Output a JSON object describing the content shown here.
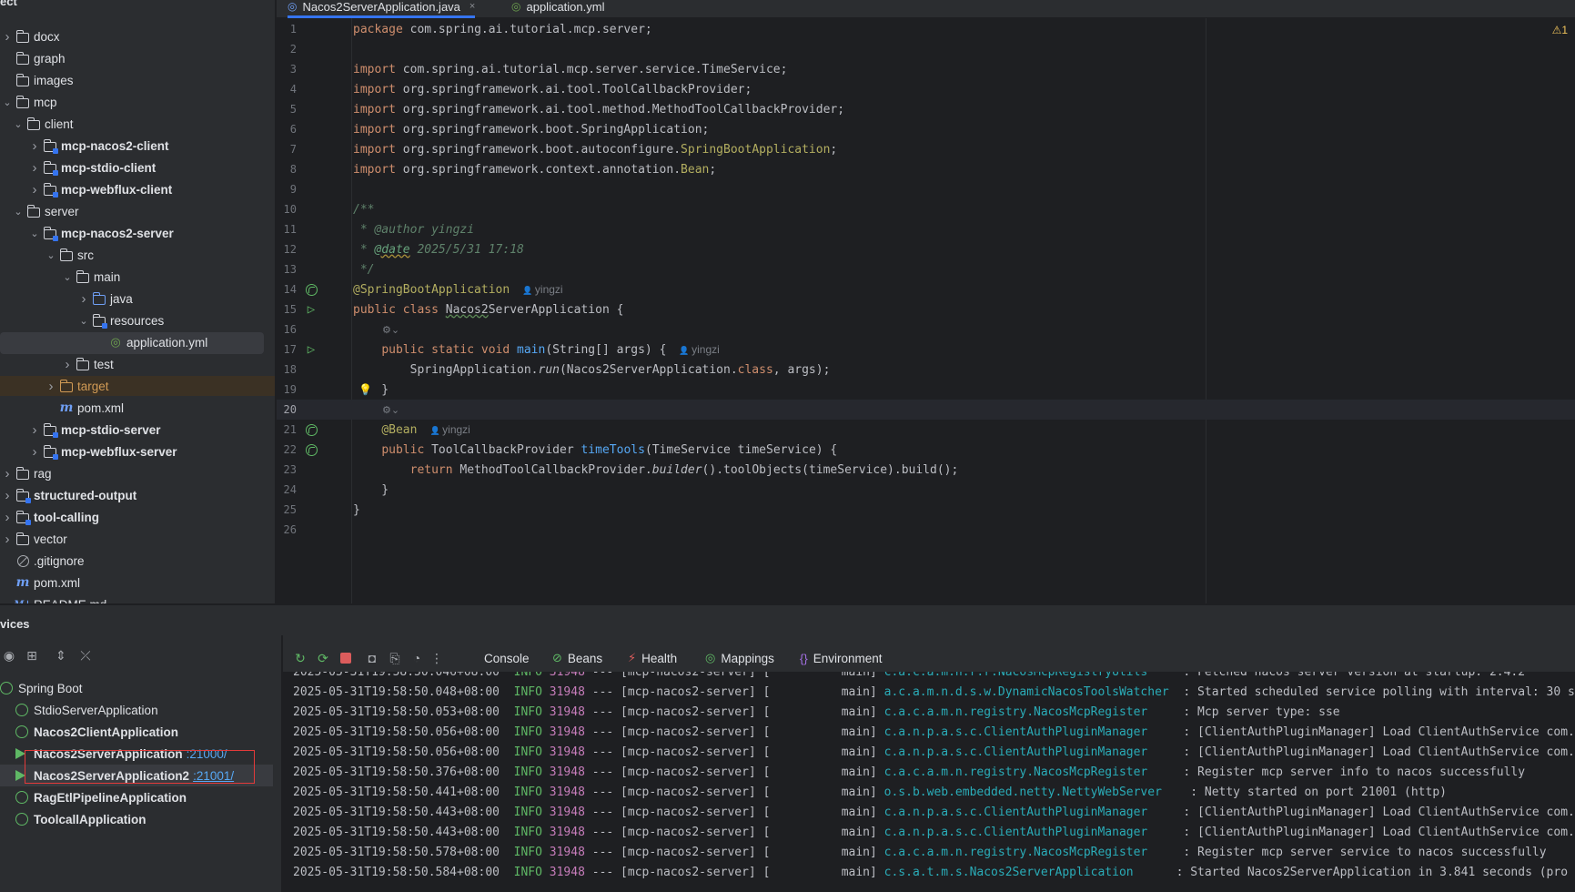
{
  "project": {
    "header": "ect",
    "items": [
      {
        "label": "docx",
        "depth": 0,
        "icon": "folder",
        "expanded": false
      },
      {
        "label": "graph",
        "depth": 0,
        "icon": "folder",
        "expanded": null
      },
      {
        "label": "images",
        "depth": 0,
        "icon": "folder",
        "expanded": null
      },
      {
        "label": "mcp",
        "depth": 0,
        "icon": "folder",
        "expanded": true
      },
      {
        "label": "client",
        "depth": 1,
        "icon": "folder",
        "expanded": true
      },
      {
        "label": "mcp-nacos2-client",
        "depth": 2,
        "icon": "module",
        "expanded": false,
        "bold": true
      },
      {
        "label": "mcp-stdio-client",
        "depth": 2,
        "icon": "module",
        "expanded": false,
        "bold": true
      },
      {
        "label": "mcp-webflux-client",
        "depth": 2,
        "icon": "module",
        "expanded": false,
        "bold": true
      },
      {
        "label": "server",
        "depth": 1,
        "icon": "folder",
        "expanded": true
      },
      {
        "label": "mcp-nacos2-server",
        "depth": 2,
        "icon": "module",
        "expanded": true,
        "bold": true
      },
      {
        "label": "src",
        "depth": 3,
        "icon": "folder",
        "expanded": true
      },
      {
        "label": "main",
        "depth": 4,
        "icon": "folder",
        "expanded": true
      },
      {
        "label": "java",
        "depth": 5,
        "icon": "folder-blue",
        "expanded": false
      },
      {
        "label": "resources",
        "depth": 5,
        "icon": "folder-res",
        "expanded": true
      },
      {
        "label": "application.yml",
        "depth": 6,
        "icon": "yml",
        "expanded": null,
        "selected": true
      },
      {
        "label": "test",
        "depth": 4,
        "icon": "folder",
        "expanded": false
      },
      {
        "label": "target",
        "depth": 3,
        "icon": "folder-orange",
        "expanded": false,
        "excluded": true
      },
      {
        "label": "pom.xml",
        "depth": 3,
        "icon": "maven",
        "expanded": null
      },
      {
        "label": "mcp-stdio-server",
        "depth": 2,
        "icon": "module",
        "expanded": false,
        "bold": true
      },
      {
        "label": "mcp-webflux-server",
        "depth": 2,
        "icon": "module",
        "expanded": false,
        "bold": true
      },
      {
        "label": "rag",
        "depth": 0,
        "icon": "folder",
        "expanded": false
      },
      {
        "label": "structured-output",
        "depth": 0,
        "icon": "module",
        "expanded": false,
        "bold": true
      },
      {
        "label": "tool-calling",
        "depth": 0,
        "icon": "module",
        "expanded": false,
        "bold": true
      },
      {
        "label": "vector",
        "depth": 0,
        "icon": "folder",
        "expanded": false
      },
      {
        "label": ".gitignore",
        "depth": 0,
        "icon": "ignore",
        "expanded": null
      },
      {
        "label": "pom.xml",
        "depth": 0,
        "icon": "maven",
        "expanded": null
      },
      {
        "label": "README.md",
        "depth": 0,
        "icon": "markdown",
        "expanded": null
      }
    ]
  },
  "tabs": [
    {
      "label": "Nacos2ServerApplication.java",
      "active": true,
      "close": "×"
    },
    {
      "label": "application.yml",
      "active": false,
      "close": ""
    }
  ],
  "editor": {
    "warning_count": "⚠1",
    "author_hint": "yingzi",
    "lines": [
      {
        "n": "1",
        "tokens": [
          [
            "kw",
            "package"
          ],
          [
            "",
            " com.spring.ai.tutorial.mcp.server;"
          ]
        ]
      },
      {
        "n": "2",
        "tokens": []
      },
      {
        "n": "3",
        "tokens": [
          [
            "kw",
            "import"
          ],
          [
            "",
            " com.spring.ai.tutorial.mcp.server.service.TimeService;"
          ]
        ]
      },
      {
        "n": "4",
        "tokens": [
          [
            "kw",
            "import"
          ],
          [
            "",
            " org.springframework.ai.tool.ToolCallbackProvider;"
          ]
        ]
      },
      {
        "n": "5",
        "tokens": [
          [
            "kw",
            "import"
          ],
          [
            "",
            " org.springframework.ai.tool.method.MethodToolCallbackProvider;"
          ]
        ]
      },
      {
        "n": "6",
        "tokens": [
          [
            "kw",
            "import"
          ],
          [
            "",
            " org.springframework.boot.SpringApplication;"
          ]
        ]
      },
      {
        "n": "7",
        "tokens": [
          [
            "kw",
            "import"
          ],
          [
            "",
            " org.springframework.boot.autoconfigure."
          ],
          [
            "ann",
            "SpringBootApplication"
          ],
          [
            "",
            ";"
          ]
        ]
      },
      {
        "n": "8",
        "tokens": [
          [
            "kw",
            "import"
          ],
          [
            "",
            " org.springframework.context.annotation."
          ],
          [
            "ann",
            "Bean"
          ],
          [
            "",
            ";"
          ]
        ]
      },
      {
        "n": "9",
        "tokens": []
      },
      {
        "n": "10",
        "tokens": [
          [
            "doc",
            "/**"
          ]
        ]
      },
      {
        "n": "11",
        "tokens": [
          [
            "doc",
            " * "
          ],
          [
            "doc-tag-plain",
            "@author"
          ],
          [
            "doc",
            " yingzi"
          ]
        ]
      },
      {
        "n": "12",
        "tokens": [
          [
            "doc",
            " * "
          ],
          [
            "doc-tag-u",
            "@date"
          ],
          [
            "doc",
            " 2025/5/31 17:18"
          ]
        ]
      },
      {
        "n": "13",
        "tokens": [
          [
            "doc",
            " */"
          ]
        ]
      },
      {
        "n": "14",
        "tokens": [
          [
            "ann",
            "@SpringBootApplication"
          ]
        ],
        "hint": true,
        "gicon": "bean"
      },
      {
        "n": "15",
        "tokens": [
          [
            "kw",
            "public class "
          ],
          [
            "typo",
            "Nacos2"
          ],
          [
            "",
            "ServerApplication {"
          ]
        ],
        "gicon": "run"
      },
      {
        "n": "16",
        "tokens": [],
        "small_hint": "⚙⌄"
      },
      {
        "n": "17",
        "tokens": [
          [
            "",
            "    "
          ],
          [
            "kw",
            "public static void "
          ],
          [
            "fn",
            "main"
          ],
          [
            "",
            "(String[] args) {"
          ]
        ],
        "hint": true,
        "gicon": "run"
      },
      {
        "n": "18",
        "tokens": [
          [
            "",
            "        SpringApplication."
          ],
          [
            "it",
            "run"
          ],
          [
            "",
            "(Nacos2ServerApplication."
          ],
          [
            "kw",
            "class"
          ],
          [
            "",
            ", args);"
          ]
        ]
      },
      {
        "n": "19",
        "tokens": [
          [
            "",
            "    }"
          ]
        ],
        "bulb": true
      },
      {
        "n": "20",
        "tokens": [],
        "current": true,
        "small_hint": "⚙⌄"
      },
      {
        "n": "21",
        "tokens": [
          [
            "",
            "    "
          ],
          [
            "ann",
            "@Bean"
          ]
        ],
        "hint": true,
        "gicon": "bean"
      },
      {
        "n": "22",
        "tokens": [
          [
            "",
            "    "
          ],
          [
            "kw",
            "public "
          ],
          [
            "",
            "ToolCallbackProvider "
          ],
          [
            "fn",
            "timeTools"
          ],
          [
            "",
            "(TimeService timeService) {"
          ]
        ],
        "gicon": "bean"
      },
      {
        "n": "23",
        "tokens": [
          [
            "",
            "        "
          ],
          [
            "kw",
            "return "
          ],
          [
            "",
            "MethodToolCallbackProvider."
          ],
          [
            "it",
            "builder"
          ],
          [
            "",
            "().toolObjects(timeService).build();"
          ]
        ]
      },
      {
        "n": "24",
        "tokens": [
          [
            "",
            "    }"
          ]
        ]
      },
      {
        "n": "25",
        "tokens": [
          [
            "",
            "}"
          ]
        ]
      },
      {
        "n": "26",
        "tokens": []
      }
    ]
  },
  "services": {
    "title": "vices",
    "root": "Spring Boot",
    "apps": [
      {
        "name": "StdioServerApplication",
        "port": "",
        "running": false,
        "bold": false
      },
      {
        "name": "Nacos2ClientApplication",
        "port": "",
        "running": false,
        "bold": true
      },
      {
        "name": "Nacos2ServerApplication",
        "port": ":21000/",
        "running": true,
        "bold": true
      },
      {
        "name": "Nacos2ServerApplication2",
        "port": ":21001/",
        "running": true,
        "bold": true,
        "selected": true
      },
      {
        "name": "RagEtlPipelineApplication",
        "port": "",
        "running": false,
        "bold": true
      },
      {
        "name": "ToolcallApplication",
        "port": "",
        "running": false,
        "bold": true
      }
    ]
  },
  "console_tabs": [
    {
      "label": "Console",
      "icon": ""
    },
    {
      "label": "Beans",
      "icon": "⊘"
    },
    {
      "label": "Health",
      "icon": "⚡"
    },
    {
      "label": "Mappings",
      "icon": "◎"
    },
    {
      "label": "Environment",
      "icon": "{}"
    }
  ],
  "console": {
    "lines": [
      {
        "ts": "2025-05-31T19:58:50.046+08:00",
        "lvl": "INFO",
        "pid": "31948",
        "app": "--- [mcp-nacos2-server] [",
        "thread": "          main]",
        "pkg": "c.a.c.a.m.n.r.r.",
        "cls": "NacosMcpRegistryUtils",
        "pad": "    ",
        "msg": ": Fetched nacos server version at startup: 2.4.2"
      },
      {
        "ts": "2025-05-31T19:58:50.048+08:00",
        "lvl": "INFO",
        "pid": "31948",
        "app": "--- [mcp-nacos2-server] [",
        "thread": "          main]",
        "pkg": "a.c.a.m.n.d.s.w.",
        "cls": "DynamicNacosToolsWatcher",
        "pad": " ",
        "msg": ": Started scheduled service polling with interval: 30 s"
      },
      {
        "ts": "2025-05-31T19:58:50.053+08:00",
        "lvl": "INFO",
        "pid": "31948",
        "app": "--- [mcp-nacos2-server] [",
        "thread": "          main]",
        "pkg": "c.a.c.a.m.n.registry.",
        "cls": "NacosMcpRegister",
        "pad": "    ",
        "msg": ": Mcp server type: sse"
      },
      {
        "ts": "2025-05-31T19:58:50.056+08:00",
        "lvl": "INFO",
        "pid": "31948",
        "app": "--- [mcp-nacos2-server] [",
        "thread": "          main]",
        "pkg": "c.a.n.p.a.s.c.",
        "cls": "ClientAuthPluginManager",
        "pad": "    ",
        "msg": ": [ClientAuthPluginManager] Load ClientAuthService com."
      },
      {
        "ts": "2025-05-31T19:58:50.056+08:00",
        "lvl": "INFO",
        "pid": "31948",
        "app": "--- [mcp-nacos2-server] [",
        "thread": "          main]",
        "pkg": "c.a.n.p.a.s.c.",
        "cls": "ClientAuthPluginManager",
        "pad": "    ",
        "msg": ": [ClientAuthPluginManager] Load ClientAuthService com."
      },
      {
        "ts": "2025-05-31T19:58:50.376+08:00",
        "lvl": "INFO",
        "pid": "31948",
        "app": "--- [mcp-nacos2-server] [",
        "thread": "          main]",
        "pkg": "c.a.c.a.m.n.registry.",
        "cls": "NacosMcpRegister",
        "pad": "    ",
        "msg": ": Register mcp server info to nacos successfully"
      },
      {
        "ts": "2025-05-31T19:58:50.441+08:00",
        "lvl": "INFO",
        "pid": "31948",
        "app": "--- [mcp-nacos2-server] [",
        "thread": "          main]",
        "pkg": "o.s.b.web.embedded.netty.",
        "cls": "NettyWebServer",
        "pad": "   ",
        "msg": ": Netty started on port 21001 (http)"
      },
      {
        "ts": "2025-05-31T19:58:50.443+08:00",
        "lvl": "INFO",
        "pid": "31948",
        "app": "--- [mcp-nacos2-server] [",
        "thread": "          main]",
        "pkg": "c.a.n.p.a.s.c.",
        "cls": "ClientAuthPluginManager",
        "pad": "    ",
        "msg": ": [ClientAuthPluginManager] Load ClientAuthService com."
      },
      {
        "ts": "2025-05-31T19:58:50.443+08:00",
        "lvl": "INFO",
        "pid": "31948",
        "app": "--- [mcp-nacos2-server] [",
        "thread": "          main]",
        "pkg": "c.a.n.p.a.s.c.",
        "cls": "ClientAuthPluginManager",
        "pad": "    ",
        "msg": ": [ClientAuthPluginManager] Load ClientAuthService com."
      },
      {
        "ts": "2025-05-31T19:58:50.578+08:00",
        "lvl": "INFO",
        "pid": "31948",
        "app": "--- [mcp-nacos2-server] [",
        "thread": "          main]",
        "pkg": "c.a.c.a.m.n.registry.",
        "cls": "NacosMcpRegister",
        "pad": "    ",
        "msg": ": Register mcp server service to nacos successfully"
      },
      {
        "ts": "2025-05-31T19:58:50.584+08:00",
        "lvl": "INFO",
        "pid": "31948",
        "app": "--- [mcp-nacos2-server] [",
        "thread": "          main]",
        "pkg": "c.s.a.t.m.s.",
        "cls": "Nacos2ServerApplication",
        "pad": "     ",
        "msg": ": Started Nacos2ServerApplication in 3.841 seconds (pro"
      }
    ]
  },
  "colors": {
    "accent": "#3574f0",
    "run_green": "#5fb865",
    "highlight_box": "#e23a3a"
  }
}
